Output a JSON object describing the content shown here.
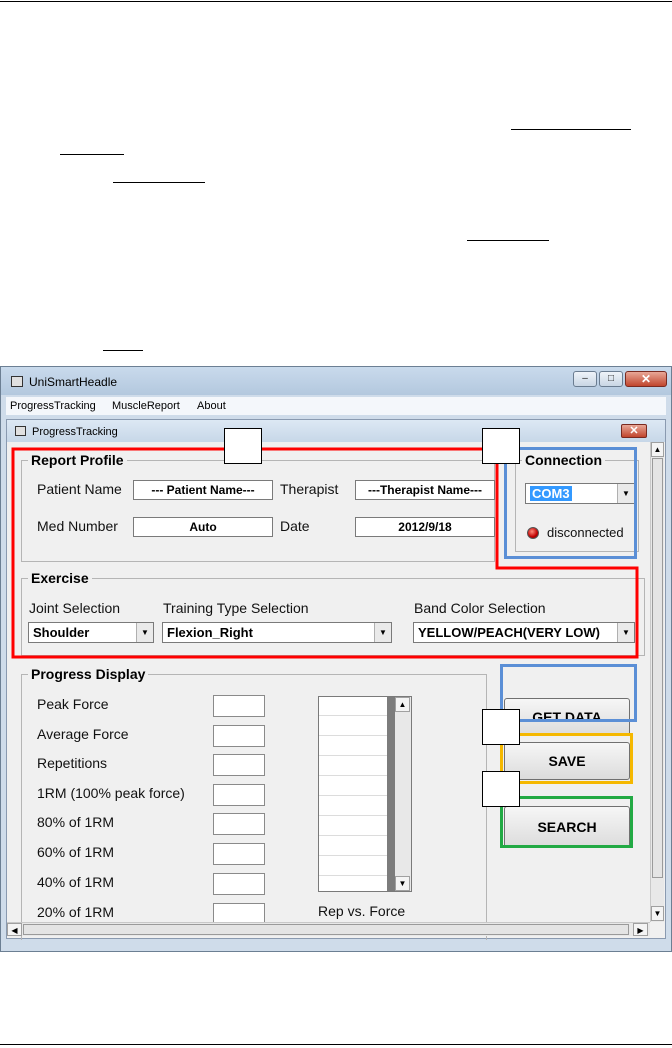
{
  "app": {
    "title": "UniSmartHeadle",
    "controls": {
      "minimize": "–",
      "maximize": "□",
      "close": "✕"
    }
  },
  "menu": [
    "ProgressTracking",
    "MuscleReport",
    "About"
  ],
  "child_window": {
    "title": "ProgressTracking",
    "close": "✕"
  },
  "report_profile": {
    "title": "Report Profile",
    "patient_name_label": "Patient Name",
    "patient_name_value": "--- Patient Name---",
    "therapist_label": "Therapist",
    "therapist_value": "---Therapist Name---",
    "med_number_label": "Med Number",
    "med_number_value": "Auto",
    "date_label": "Date",
    "date_value": "2012/9/18"
  },
  "connection": {
    "title": "Connection",
    "port": "COM3",
    "status": "disconnected",
    "status_color": "#cc0000"
  },
  "exercise": {
    "title": "Exercise",
    "joint_label": "Joint Selection",
    "joint_value": "Shoulder",
    "training_label": "Training Type Selection",
    "training_value": "Flexion_Right",
    "band_label": "Band Color Selection",
    "band_value": "YELLOW/PEACH(VERY LOW)"
  },
  "progress": {
    "title": "Progress Display",
    "metrics": [
      "Peak Force",
      "Average Force",
      "Repetitions",
      "1RM (100% peak force)",
      "80% of 1RM",
      "60% of 1RM",
      "40% of 1RM",
      "20% of 1RM"
    ],
    "list_caption": "Rep vs. Force"
  },
  "buttons": {
    "get_data": "GET DATA",
    "save": "SAVE",
    "search": "SEARCH"
  },
  "highlight_colors": {
    "red": "#ff0000",
    "blue": "#5b8fd6",
    "yellow": "#f5b800",
    "green": "#22aa44"
  }
}
